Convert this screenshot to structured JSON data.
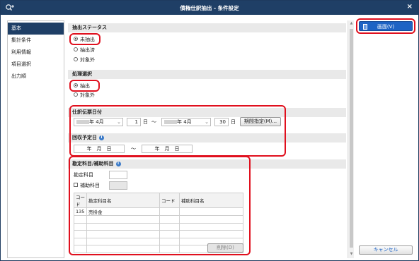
{
  "window": {
    "title": "債権仕訳抽出 - 条件設定",
    "close_label": "×"
  },
  "sidebar": {
    "items": [
      {
        "label": "基本"
      },
      {
        "label": "集計条件"
      },
      {
        "label": "利用情報"
      },
      {
        "label": "項目選択"
      },
      {
        "label": "出力順"
      }
    ]
  },
  "extract_status": {
    "heading": "抽出ステータス",
    "options": [
      "未抽出",
      "抽出済",
      "対象外"
    ],
    "selected": "未抽出"
  },
  "process_select": {
    "heading": "処理選択",
    "options": [
      "抽出",
      "対象外"
    ],
    "selected": "抽出"
  },
  "journal_date": {
    "heading": "仕訳伝票日付",
    "from_month": "年 4月",
    "from_day": "1",
    "day_unit": "日",
    "tilde": "～",
    "to_month": "年 4月",
    "to_day": "30",
    "period_button": "期間指定(M)..."
  },
  "collection_date": {
    "heading": "回収予定日",
    "from": "年　月　日",
    "to": "年　月　日",
    "tilde": "～"
  },
  "account": {
    "heading": "勘定科目/補助科目",
    "account_label": "勘定科目",
    "sub_label": "補助科目",
    "table": {
      "headers": [
        "コード",
        "勘定科目名",
        "コード",
        "補助科目名"
      ],
      "rows": [
        [
          "135",
          "売掛金",
          "",
          ""
        ],
        [
          "",
          "",
          "",
          ""
        ],
        [
          "",
          "",
          "",
          ""
        ],
        [
          "",
          "",
          "",
          ""
        ],
        [
          "",
          "",
          "",
          ""
        ],
        [
          "",
          "",
          "",
          ""
        ]
      ]
    },
    "delete_button": "削除(D)"
  },
  "actions": {
    "screen_button": "画面(V)",
    "cancel_button": "キャンセル"
  },
  "colors": {
    "titlebar": "#1f3f66",
    "highlight": "#e0101e",
    "primary_button": "#1e63c4"
  }
}
